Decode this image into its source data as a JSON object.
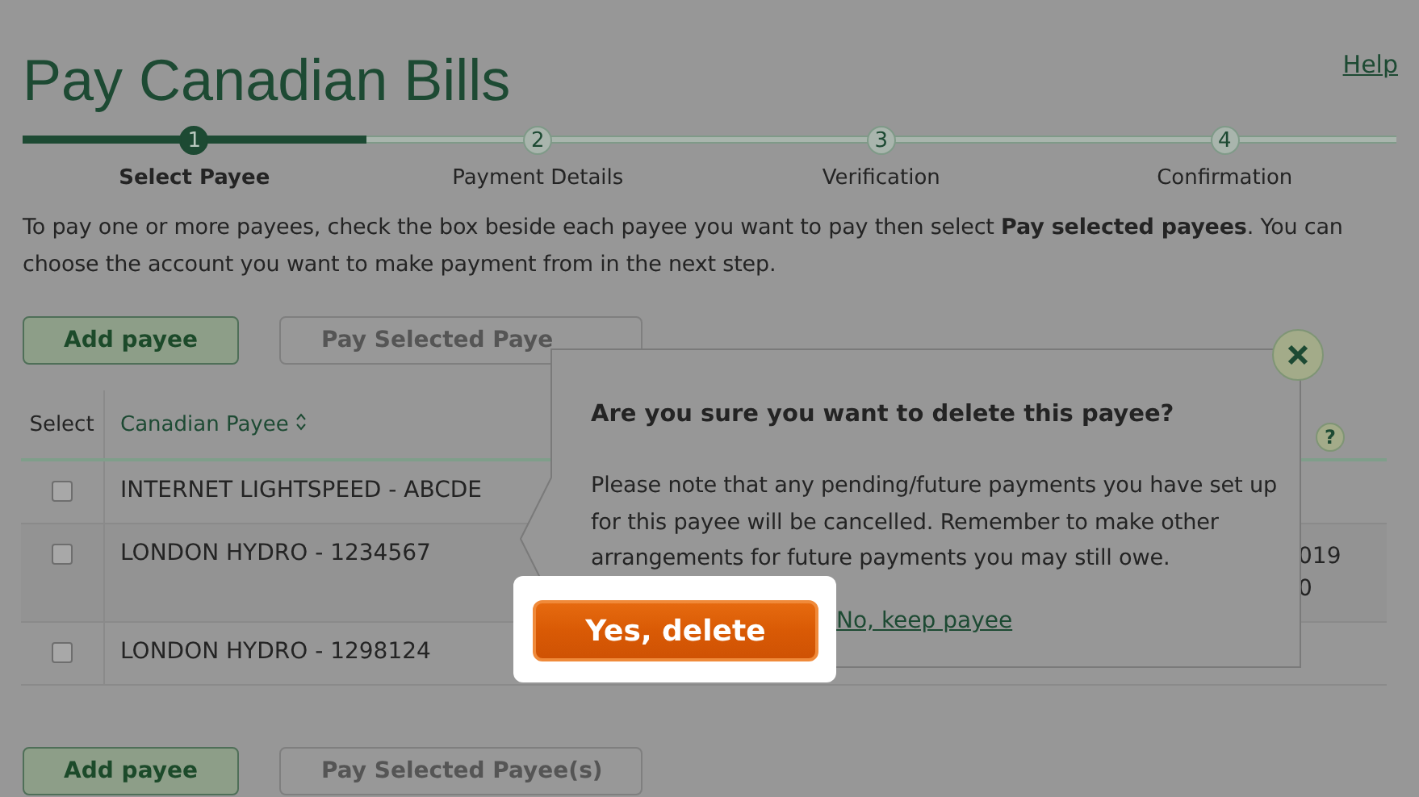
{
  "page": {
    "title": "Pay Canadian Bills",
    "help_link": "Help"
  },
  "steps": [
    {
      "number": "1",
      "label": "Select Payee",
      "selected": true
    },
    {
      "number": "2",
      "label": "Payment Details",
      "selected": false
    },
    {
      "number": "3",
      "label": "Verification",
      "selected": false
    },
    {
      "number": "4",
      "label": "Confirmation",
      "selected": false
    }
  ],
  "instructions": "To pay one or more payees, check the box beside each payee you want to pay then select **Pay selected payees**. You can choose the account you want to make payment from in the next step.",
  "top_buttons": [
    {
      "label": "Add payee",
      "kind": "primary"
    },
    {
      "label": "Pay Selected Paye",
      "kind": "secondary"
    }
  ],
  "table": {
    "help_icon": "?",
    "columns": [
      {
        "label": "Select",
        "sortable": false
      },
      {
        "label": "Canadian Payee",
        "sortable": true
      }
    ],
    "rows": [
      {
        "checked": false,
        "payee": "INTERNET LIGHTSPEED - ABCDE",
        "column_3": []
      },
      {
        "checked": false,
        "payee": "LONDON HYDRO - 1234567",
        "column_3": [
          "019",
          "0"
        ]
      },
      {
        "checked": false,
        "payee": "LONDON HYDRO - 1298124",
        "column_3": []
      }
    ]
  },
  "bottom_buttons": [
    {
      "label": "Add payee",
      "kind": "primary"
    },
    {
      "label": "Pay Selected Payee(s)",
      "kind": "secondary"
    }
  ],
  "dialog": {
    "title": "Are you sure you want to delete this payee?",
    "message": "Please note that any pending/future payments you have set up for this payee will be cancelled. Remember to make other arrangements for future payments you may still owe.",
    "confirm_button": "Yes, delete",
    "cancel_link": "No, keep payee"
  }
}
